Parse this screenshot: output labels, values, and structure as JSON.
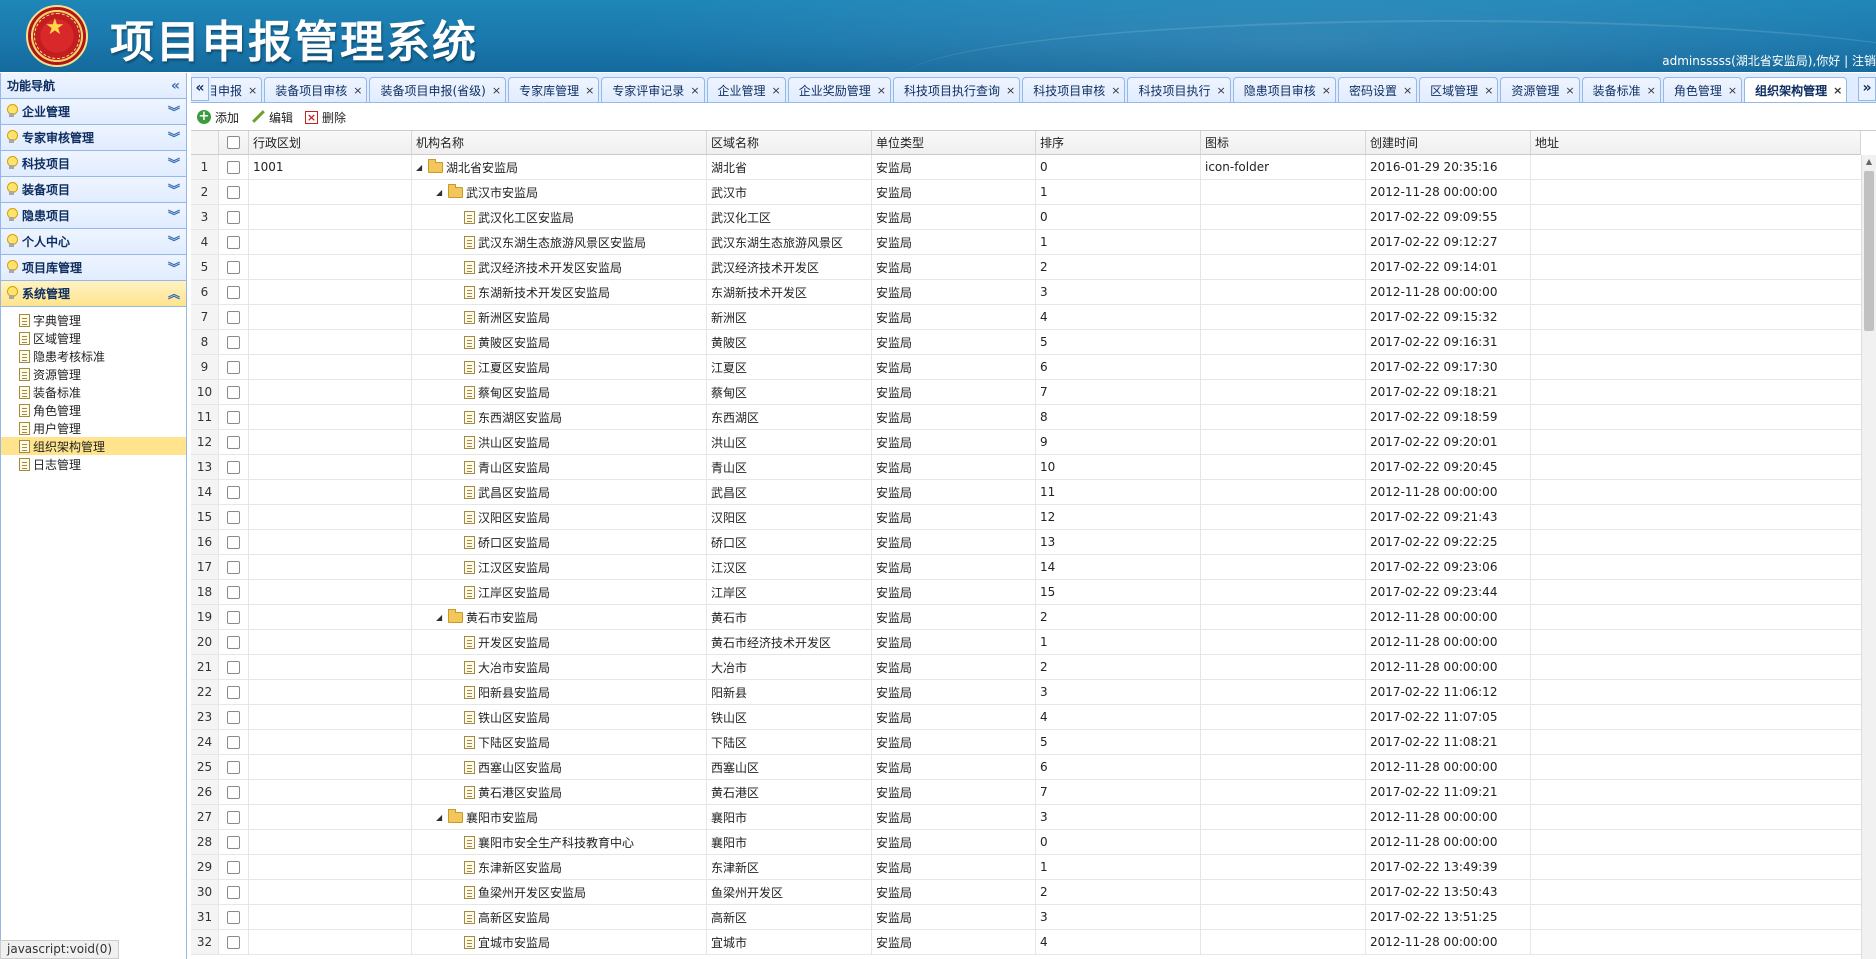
{
  "app": {
    "title": "项目申报管理系统",
    "user_info": "adminsssss(湖北省安监局),你好",
    "logout_label": "注销"
  },
  "sidebar": {
    "header": "功能导航",
    "sections": [
      {
        "label": "企业管理",
        "expanded": false
      },
      {
        "label": "专家审核管理",
        "expanded": false
      },
      {
        "label": "科技项目",
        "expanded": false
      },
      {
        "label": "装备项目",
        "expanded": false
      },
      {
        "label": "隐患项目",
        "expanded": false
      },
      {
        "label": "个人中心",
        "expanded": false
      },
      {
        "label": "项目库管理",
        "expanded": false
      },
      {
        "label": "系统管理",
        "expanded": true
      }
    ],
    "sub_items": [
      "字典管理",
      "区域管理",
      "隐患考核标准",
      "资源管理",
      "装备标准",
      "角色管理",
      "用户管理",
      "组织架构管理",
      "日志管理"
    ],
    "selected_sub_item": "组织架构管理"
  },
  "tabs": [
    "目申报",
    "装备项目审核",
    "装备项目申报(省级)",
    "专家库管理",
    "专家评审记录",
    "企业管理",
    "企业奖励管理",
    "科技项目执行查询",
    "科技项目审核",
    "科技项目执行",
    "隐患项目审核",
    "密码设置",
    "区域管理",
    "资源管理",
    "装备标准",
    "角色管理",
    "组织架构管理"
  ],
  "active_tab": "组织架构管理",
  "toolbar": {
    "add": "添加",
    "edit": "编辑",
    "delete": "删除"
  },
  "grid": {
    "columns": [
      "行政区划",
      "机构名称",
      "区域名称",
      "单位类型",
      "排序",
      "图标",
      "创建时间",
      "地址"
    ],
    "rows": [
      {
        "no": "1",
        "code": "1001",
        "name": "湖北省安监局",
        "level": 0,
        "kind": "folder",
        "area": "湖北省",
        "type": "安监局",
        "order": "0",
        "icon": "icon-folder",
        "time": "2016-01-29 20:35:16",
        "addr": ""
      },
      {
        "no": "2",
        "code": "",
        "name": "武汉市安监局",
        "level": 1,
        "kind": "folder",
        "area": "武汉市",
        "type": "安监局",
        "order": "1",
        "icon": "",
        "time": "2012-11-28 00:00:00",
        "addr": ""
      },
      {
        "no": "3",
        "code": "",
        "name": "武汉化工区安监局",
        "level": 2,
        "kind": "file",
        "area": "武汉化工区",
        "type": "安监局",
        "order": "0",
        "icon": "",
        "time": "2017-02-22 09:09:55",
        "addr": ""
      },
      {
        "no": "4",
        "code": "",
        "name": "武汉东湖生态旅游风景区安监局",
        "level": 2,
        "kind": "file",
        "area": "武汉东湖生态旅游风景区",
        "type": "安监局",
        "order": "1",
        "icon": "",
        "time": "2017-02-22 09:12:27",
        "addr": ""
      },
      {
        "no": "5",
        "code": "",
        "name": "武汉经济技术开发区安监局",
        "level": 2,
        "kind": "file",
        "area": "武汉经济技术开发区",
        "type": "安监局",
        "order": "2",
        "icon": "",
        "time": "2017-02-22 09:14:01",
        "addr": ""
      },
      {
        "no": "6",
        "code": "",
        "name": "东湖新技术开发区安监局",
        "level": 2,
        "kind": "file",
        "area": "东湖新技术开发区",
        "type": "安监局",
        "order": "3",
        "icon": "",
        "time": "2012-11-28 00:00:00",
        "addr": ""
      },
      {
        "no": "7",
        "code": "",
        "name": "新洲区安监局",
        "level": 2,
        "kind": "file",
        "area": "新洲区",
        "type": "安监局",
        "order": "4",
        "icon": "",
        "time": "2017-02-22 09:15:32",
        "addr": ""
      },
      {
        "no": "8",
        "code": "",
        "name": "黄陂区安监局",
        "level": 2,
        "kind": "file",
        "area": "黄陂区",
        "type": "安监局",
        "order": "5",
        "icon": "",
        "time": "2017-02-22 09:16:31",
        "addr": ""
      },
      {
        "no": "9",
        "code": "",
        "name": "江夏区安监局",
        "level": 2,
        "kind": "file",
        "area": "江夏区",
        "type": "安监局",
        "order": "6",
        "icon": "",
        "time": "2017-02-22 09:17:30",
        "addr": ""
      },
      {
        "no": "10",
        "code": "",
        "name": "蔡甸区安监局",
        "level": 2,
        "kind": "file",
        "area": "蔡甸区",
        "type": "安监局",
        "order": "7",
        "icon": "",
        "time": "2017-02-22 09:18:21",
        "addr": ""
      },
      {
        "no": "11",
        "code": "",
        "name": "东西湖区安监局",
        "level": 2,
        "kind": "file",
        "area": "东西湖区",
        "type": "安监局",
        "order": "8",
        "icon": "",
        "time": "2017-02-22 09:18:59",
        "addr": ""
      },
      {
        "no": "12",
        "code": "",
        "name": "洪山区安监局",
        "level": 2,
        "kind": "file",
        "area": "洪山区",
        "type": "安监局",
        "order": "9",
        "icon": "",
        "time": "2017-02-22 09:20:01",
        "addr": ""
      },
      {
        "no": "13",
        "code": "",
        "name": "青山区安监局",
        "level": 2,
        "kind": "file",
        "area": "青山区",
        "type": "安监局",
        "order": "10",
        "icon": "",
        "time": "2017-02-22 09:20:45",
        "addr": ""
      },
      {
        "no": "14",
        "code": "",
        "name": "武昌区安监局",
        "level": 2,
        "kind": "file",
        "area": "武昌区",
        "type": "安监局",
        "order": "11",
        "icon": "",
        "time": "2012-11-28 00:00:00",
        "addr": ""
      },
      {
        "no": "15",
        "code": "",
        "name": "汉阳区安监局",
        "level": 2,
        "kind": "file",
        "area": "汉阳区",
        "type": "安监局",
        "order": "12",
        "icon": "",
        "time": "2017-02-22 09:21:43",
        "addr": ""
      },
      {
        "no": "16",
        "code": "",
        "name": "硚口区安监局",
        "level": 2,
        "kind": "file",
        "area": "硚口区",
        "type": "安监局",
        "order": "13",
        "icon": "",
        "time": "2017-02-22 09:22:25",
        "addr": ""
      },
      {
        "no": "17",
        "code": "",
        "name": "江汉区安监局",
        "level": 2,
        "kind": "file",
        "area": "江汉区",
        "type": "安监局",
        "order": "14",
        "icon": "",
        "time": "2017-02-22 09:23:06",
        "addr": ""
      },
      {
        "no": "18",
        "code": "",
        "name": "江岸区安监局",
        "level": 2,
        "kind": "file",
        "area": "江岸区",
        "type": "安监局",
        "order": "15",
        "icon": "",
        "time": "2017-02-22 09:23:44",
        "addr": ""
      },
      {
        "no": "19",
        "code": "",
        "name": "黄石市安监局",
        "level": 1,
        "kind": "folder",
        "area": "黄石市",
        "type": "安监局",
        "order": "2",
        "icon": "",
        "time": "2012-11-28 00:00:00",
        "addr": ""
      },
      {
        "no": "20",
        "code": "",
        "name": "开发区安监局",
        "level": 2,
        "kind": "file",
        "area": "黄石市经济技术开发区",
        "type": "安监局",
        "order": "1",
        "icon": "",
        "time": "2012-11-28 00:00:00",
        "addr": ""
      },
      {
        "no": "21",
        "code": "",
        "name": "大冶市安监局",
        "level": 2,
        "kind": "file",
        "area": "大冶市",
        "type": "安监局",
        "order": "2",
        "icon": "",
        "time": "2012-11-28 00:00:00",
        "addr": ""
      },
      {
        "no": "22",
        "code": "",
        "name": "阳新县安监局",
        "level": 2,
        "kind": "file",
        "area": "阳新县",
        "type": "安监局",
        "order": "3",
        "icon": "",
        "time": "2017-02-22 11:06:12",
        "addr": ""
      },
      {
        "no": "23",
        "code": "",
        "name": "铁山区安监局",
        "level": 2,
        "kind": "file",
        "area": "铁山区",
        "type": "安监局",
        "order": "4",
        "icon": "",
        "time": "2017-02-22 11:07:05",
        "addr": ""
      },
      {
        "no": "24",
        "code": "",
        "name": "下陆区安监局",
        "level": 2,
        "kind": "file",
        "area": "下陆区",
        "type": "安监局",
        "order": "5",
        "icon": "",
        "time": "2017-02-22 11:08:21",
        "addr": ""
      },
      {
        "no": "25",
        "code": "",
        "name": "西塞山区安监局",
        "level": 2,
        "kind": "file",
        "area": "西塞山区",
        "type": "安监局",
        "order": "6",
        "icon": "",
        "time": "2012-11-28 00:00:00",
        "addr": ""
      },
      {
        "no": "26",
        "code": "",
        "name": "黄石港区安监局",
        "level": 2,
        "kind": "file",
        "area": "黄石港区",
        "type": "安监局",
        "order": "7",
        "icon": "",
        "time": "2017-02-22 11:09:21",
        "addr": ""
      },
      {
        "no": "27",
        "code": "",
        "name": "襄阳市安监局",
        "level": 1,
        "kind": "folder",
        "area": "襄阳市",
        "type": "安监局",
        "order": "3",
        "icon": "",
        "time": "2012-11-28 00:00:00",
        "addr": ""
      },
      {
        "no": "28",
        "code": "",
        "name": "襄阳市安全生产科技教育中心",
        "level": 2,
        "kind": "file",
        "area": "襄阳市",
        "type": "安监局",
        "order": "0",
        "icon": "",
        "time": "2012-11-28 00:00:00",
        "addr": ""
      },
      {
        "no": "29",
        "code": "",
        "name": "东津新区安监局",
        "level": 2,
        "kind": "file",
        "area": "东津新区",
        "type": "安监局",
        "order": "1",
        "icon": "",
        "time": "2017-02-22 13:49:39",
        "addr": ""
      },
      {
        "no": "30",
        "code": "",
        "name": "鱼梁州开发区安监局",
        "level": 2,
        "kind": "file",
        "area": "鱼梁州开发区",
        "type": "安监局",
        "order": "2",
        "icon": "",
        "time": "2017-02-22 13:50:43",
        "addr": ""
      },
      {
        "no": "31",
        "code": "",
        "name": "高新区安监局",
        "level": 2,
        "kind": "file",
        "area": "高新区",
        "type": "安监局",
        "order": "3",
        "icon": "",
        "time": "2017-02-22 13:51:25",
        "addr": ""
      },
      {
        "no": "32",
        "code": "",
        "name": "宜城市安监局",
        "level": 2,
        "kind": "file",
        "area": "宜城市",
        "type": "安监局",
        "order": "4",
        "icon": "",
        "time": "2012-11-28 00:00:00",
        "addr": ""
      }
    ]
  },
  "status_bar": "javascript:void(0)"
}
